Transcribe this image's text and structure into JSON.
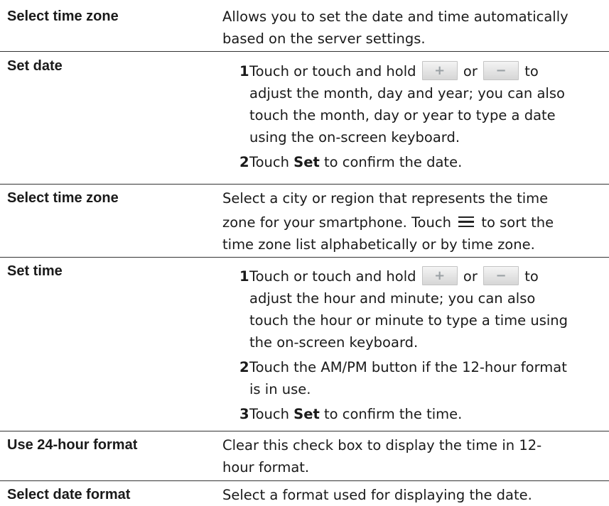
{
  "rows": [
    {
      "term": "Select time zone",
      "desc_lines": [
        "Allows you to set the date and time automatically",
        "based on the server settings."
      ]
    },
    {
      "term": "Set date",
      "steps": [
        {
          "num": "1",
          "line1_before": "Touch or touch and hold",
          "connector": "or",
          "line1_after": "to",
          "rest_lines": [
            "adjust the month, day and year; you can also",
            "touch the month, day or year to type a date",
            "using the on-screen keyboard."
          ]
        },
        {
          "num": "2",
          "pre": "Touch ",
          "bold": "Set",
          "post": " to confirm the date."
        }
      ]
    },
    {
      "term": "Select time zone",
      "desc_lines": [
        "Select a city or region that represents the time"
      ],
      "line2_before": "zone for your smartphone. Touch",
      "line2_after": "to sort the",
      "desc_line3": "time zone list alphabetically or by time zone."
    },
    {
      "term": "Set time",
      "steps": [
        {
          "num": "1",
          "line1_before": "Touch or touch and hold",
          "connector": "or",
          "line1_after": "to",
          "rest_lines": [
            "adjust the hour and minute; you can also",
            "touch the hour or minute to type a time using",
            "the on-screen keyboard."
          ]
        },
        {
          "num": "2",
          "lines": [
            "Touch the AM/PM button if the 12-hour format",
            "is in use."
          ]
        },
        {
          "num": "3",
          "pre": "Touch ",
          "bold": "Set",
          "post": " to confirm the time."
        }
      ]
    },
    {
      "term": "Use 24-hour format",
      "desc_lines": [
        "Clear this check box to display the time in 12-",
        "hour format."
      ]
    },
    {
      "term": "Select date format",
      "desc_lines": [
        "Select a format used for displaying the date."
      ]
    }
  ],
  "icons": {
    "plus": "+",
    "minus": "−",
    "menu": "menu-icon"
  }
}
